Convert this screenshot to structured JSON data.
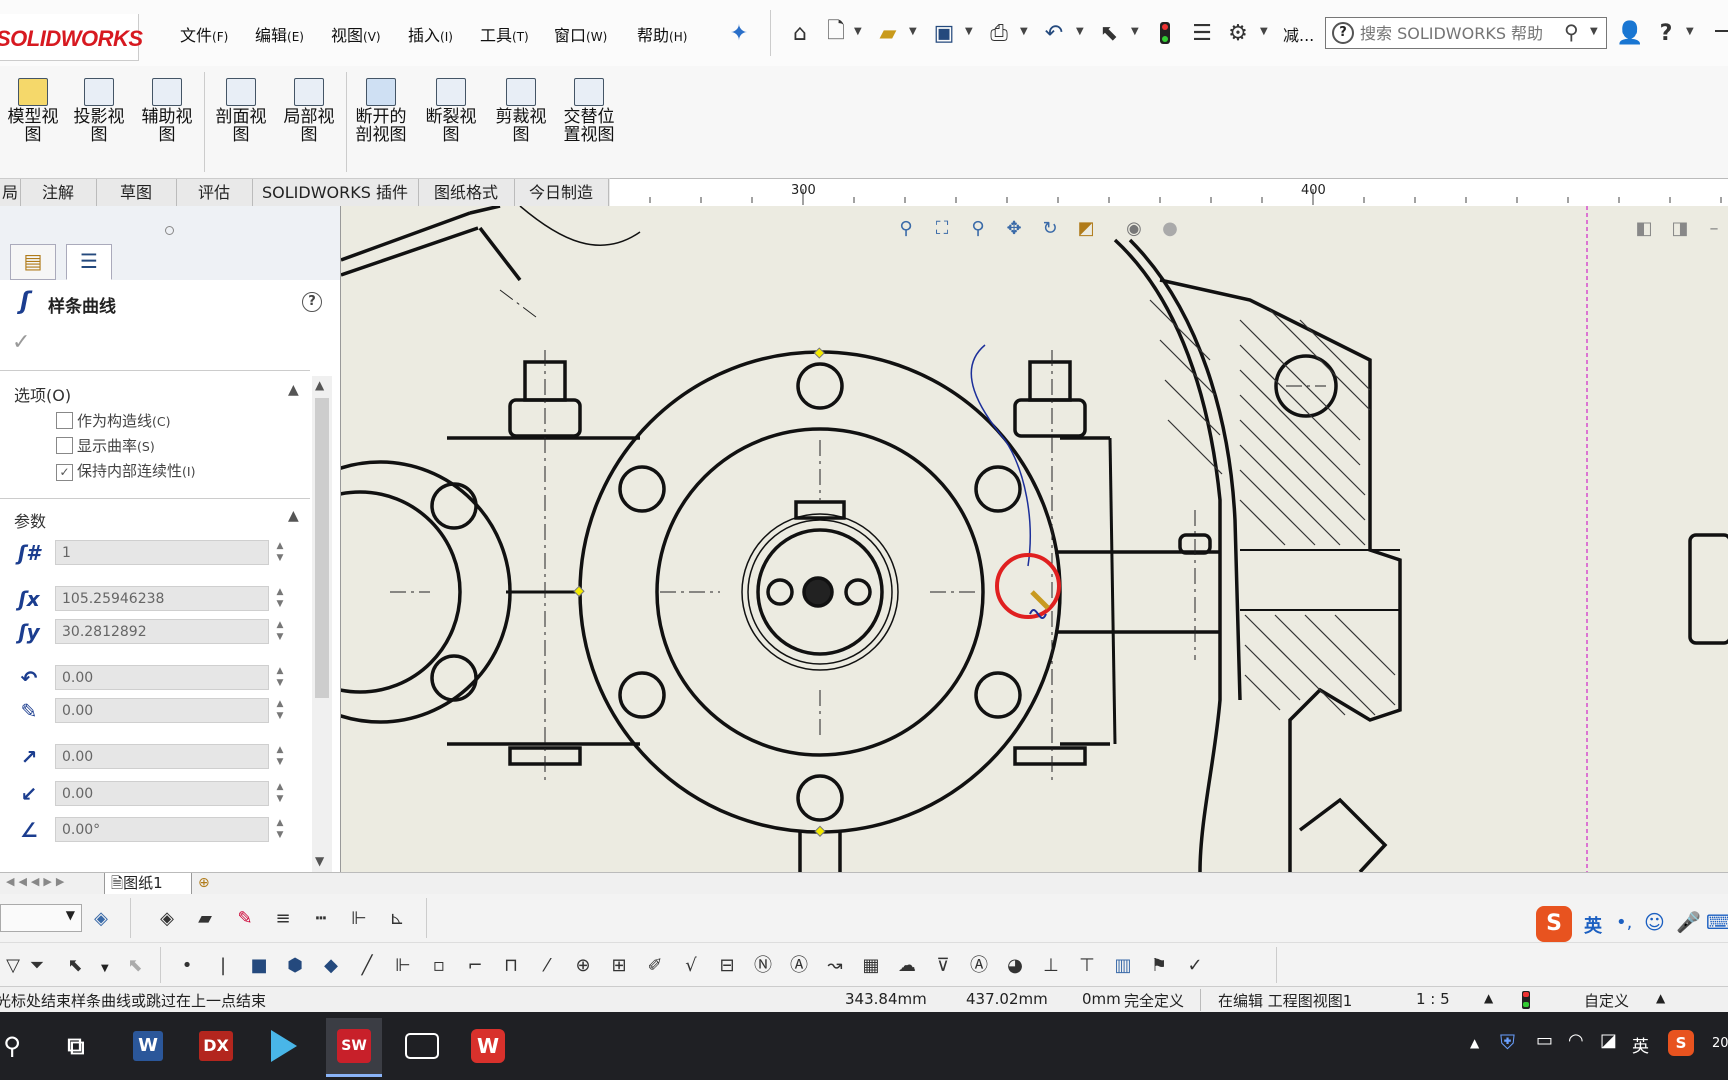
{
  "app": {
    "logo": "SOLIDWORKS",
    "accent": "#d71920"
  },
  "menu": [
    {
      "label": "文件",
      "key": "(F)"
    },
    {
      "label": "编辑",
      "key": "(E)"
    },
    {
      "label": "视图",
      "key": "(V)"
    },
    {
      "label": "插入",
      "key": "(I)"
    },
    {
      "label": "工具",
      "key": "(T)"
    },
    {
      "label": "窗口",
      "key": "(W)"
    },
    {
      "label": "帮助",
      "key": "(H)"
    }
  ],
  "toolbar": {
    "more_label": "减..."
  },
  "search": {
    "placeholder": "搜索 SOLIDWORKS 帮助"
  },
  "ribbon": [
    {
      "line1": "模型视",
      "line2": "图"
    },
    {
      "line1": "投影视",
      "line2": "图"
    },
    {
      "line1": "辅助视",
      "line2": "图"
    },
    {
      "line1": "剖面视",
      "line2": "图"
    },
    {
      "line1": "局部视",
      "line2": "图"
    },
    {
      "line1": "断开的",
      "line2": "剖视图"
    },
    {
      "line1": "断裂视",
      "line2": "图"
    },
    {
      "line1": "剪裁视",
      "line2": "图"
    },
    {
      "line1": "交替位",
      "line2": "置视图"
    }
  ],
  "tabs": [
    "局",
    "注解",
    "草图",
    "评估",
    "SOLIDWORKS 插件",
    "图纸格式",
    "今日制造"
  ],
  "ruler": {
    "mark1": "300",
    "mark2": "400"
  },
  "pm": {
    "title": "样条曲线",
    "options_header": "选项(O)",
    "options": [
      {
        "label": "作为构造线",
        "key": "(C)",
        "checked": false
      },
      {
        "label": "显示曲率",
        "key": "(S)",
        "checked": false
      },
      {
        "label": "保持内部连续性",
        "key": "(I)",
        "checked": true
      }
    ],
    "params_header": "参数",
    "fields": [
      "1",
      "105.25946238",
      "30.2812892",
      "0.00",
      "0.00",
      "0.00",
      "0.00",
      "0.00°"
    ]
  },
  "sheet": {
    "tab": "图纸1"
  },
  "status": {
    "message": "光标处结束样条曲线或跳过在上一点结束",
    "x": "343.84mm",
    "y": "437.02mm",
    "z": "0mm",
    "state": "完全定义",
    "editing": "在编辑 工程图视图1",
    "scale": "1 : 5",
    "custom": "自定义"
  },
  "ime": {
    "lang": "英"
  },
  "tray": {
    "lang": "英",
    "clock": "20"
  }
}
